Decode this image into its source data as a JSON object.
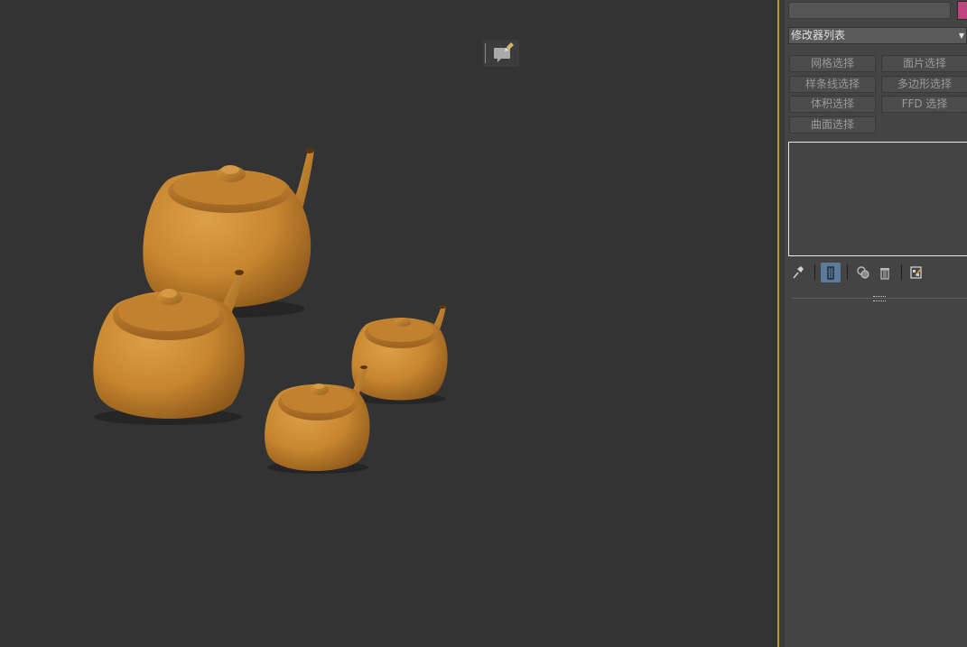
{
  "viewport": {
    "objects": [
      "teapot",
      "teapot",
      "teapot",
      "teapot"
    ],
    "object_color": "#c7862f"
  },
  "panel": {
    "name_value": "",
    "swatch_color": "#c0457f",
    "modifier_list_label": "修改器列表",
    "selection_buttons": {
      "mesh_select": "网格选择",
      "patch_select": "面片选择",
      "spline_select": "样条线选择",
      "poly_select": "多边形选择",
      "vol_select": "体积选择",
      "ffd_select": "FFD 选择",
      "surface_select": "曲面选择"
    },
    "stack_items": []
  },
  "icons": {
    "annotation": "annotation-edit-icon",
    "pin": "pin-stack-icon",
    "show_end": "show-end-result-icon",
    "unique": "make-unique-icon",
    "remove": "remove-modifier-icon",
    "configure": "configure-modifier-sets-icon"
  }
}
